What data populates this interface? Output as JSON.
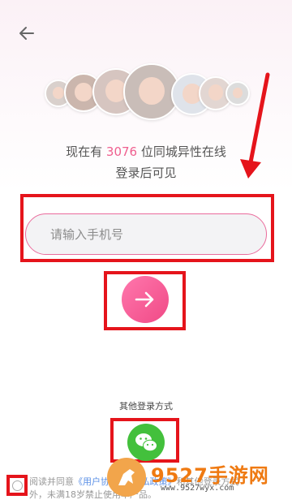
{
  "header": {
    "back_icon": "arrow-left-icon"
  },
  "avatars": [
    {
      "name": "avatar-1",
      "bg": "#d9d0cc",
      "hair": "#3a2a24"
    },
    {
      "name": "avatar-2",
      "bg": "#cbb6ad",
      "hair": "#4a3024"
    },
    {
      "name": "avatar-3",
      "bg": "#d6c5c0",
      "hair": "#2d1f1b"
    },
    {
      "name": "avatar-4",
      "bg": "#c9bdb8",
      "hair": "#20160f"
    },
    {
      "name": "avatar-5",
      "bg": "#dfe3ea",
      "hair": "#3a2b27"
    },
    {
      "name": "avatar-6",
      "bg": "#e2d6d2",
      "hair": "#3d2a22"
    },
    {
      "name": "avatar-7",
      "bg": "#dcdcdc",
      "hair": "#34261f"
    }
  ],
  "hero": {
    "prefix": "现在有 ",
    "count": "3076",
    "suffix": " 位同城异性在线",
    "subline": "登录后可见"
  },
  "login": {
    "phone_placeholder": "请输入手机号",
    "phone_value": "",
    "next_icon": "arrow-right-icon"
  },
  "other_login": {
    "label": "其他登录方式",
    "wechat_icon": "wechat-icon"
  },
  "agreement": {
    "line1_prefix": "阅读并同意",
    "link1": "《用户协议》",
    "link2": "《隐私政策》",
    "line1_suffix": "和其他登录方式",
    "line2": "外，未满18岁禁止使用本产品。"
  },
  "watermark": {
    "title": "9527手游网",
    "url": "www.9527wyx.com"
  },
  "colors": {
    "accent": "#ef5f8f",
    "annotation": "#e5141b",
    "wechat": "#43c03c",
    "link": "#5a8fe6"
  }
}
